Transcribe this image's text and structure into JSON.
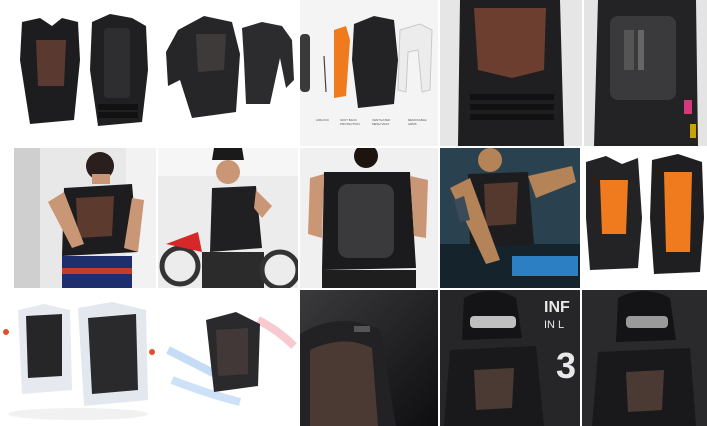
{
  "results": {
    "tiles": [
      {
        "name": "vest-front-back-studio"
      },
      {
        "name": "jacket-with-sleeves-studio"
      },
      {
        "name": "vest-exploded-components",
        "captions": [
          "AIRLOCK",
          "SOFT BACK PROTECTION",
          "VENTILATED MESH VEST",
          "REMOVABLE ARMS"
        ]
      },
      {
        "name": "vest-closeup-front"
      },
      {
        "name": "vest-closeup-back-pocket"
      },
      {
        "name": "rider-fastening-vest"
      },
      {
        "name": "rider-monster-cap-motocross"
      },
      {
        "name": "rider-back-view-vest"
      },
      {
        "name": "tattooed-rider-adjusting-vest"
      },
      {
        "name": "vest-orange-inserts"
      },
      {
        "name": "vest-airflow-diagram"
      },
      {
        "name": "vest-airflow-render"
      },
      {
        "name": "vest-dark-shoulder-closeup"
      },
      {
        "name": "helmet-rider-infographic",
        "text_lines": [
          "INF",
          "IN L",
          "3"
        ]
      },
      {
        "name": "helmet-rider-dark"
      }
    ],
    "accent": "#e0502a",
    "insert_orange": "#f07b1e"
  }
}
